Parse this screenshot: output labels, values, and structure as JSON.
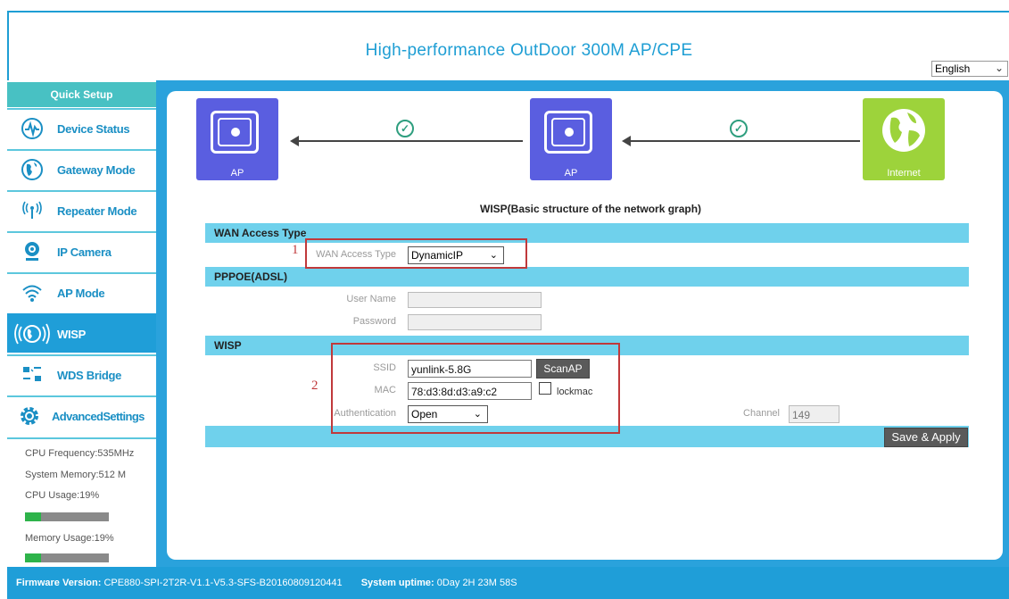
{
  "header": {
    "title": "High-performance OutDoor 300M AP/CPE",
    "language": "English"
  },
  "sidebar": {
    "quick_setup": "Quick Setup",
    "items": [
      {
        "label": "Device Status",
        "icon": "pulse-icon"
      },
      {
        "label": "Gateway Mode",
        "icon": "globe-icon"
      },
      {
        "label": "Repeater Mode",
        "icon": "antenna-icon"
      },
      {
        "label": "IP Camera",
        "icon": "camera-icon"
      },
      {
        "label": "AP Mode",
        "icon": "wifi-icon"
      },
      {
        "label": "WISP",
        "icon": "wisp-globe-icon",
        "active": true
      },
      {
        "label": "WDS Bridge",
        "icon": "bridge-icon"
      },
      {
        "label": "AdvancedSettings",
        "icon": "gear-icon"
      }
    ],
    "stats": {
      "cpu_freq": "CPU Frequency:535MHz",
      "memory": "System Memory:512 M",
      "cpu_usage": "CPU Usage:19%",
      "cpu_usage_value": 0.19,
      "mem_usage": "Memory Usage:19%",
      "mem_usage_value": 0.19
    }
  },
  "diagram": {
    "ap1_label": "AP",
    "ap2_label": "AP",
    "internet_label": "Internet",
    "caption": "WISP(Basic structure of the network graph)"
  },
  "sections": {
    "wan": "WAN Access Type",
    "pppoe": "PPPOE(ADSL)",
    "wisp": "WISP"
  },
  "form": {
    "wan_access_label": "WAN Access Type",
    "wan_access_value": "DynamicIP",
    "username_label": "User Name",
    "password_label": "Password",
    "ssid_label": "SSID",
    "ssid_value": "yunlink-5.8G",
    "scan_button": "ScanAP",
    "mac_label": "MAC",
    "mac_value": "78:d3:8d:d3:a9:c2",
    "lockmac_label": "lockmac",
    "auth_label": "Authentication",
    "auth_value": "Open",
    "channel_label": "Channel",
    "channel_value": "149",
    "save_button": "Save & Apply"
  },
  "annotations": {
    "marker1": "1",
    "marker2": "2"
  },
  "footer": {
    "firmware_label": "Firmware Version:",
    "firmware_value": "CPE880-SPI-2T2R-V1.1-V5.3-SFS-B20160809120441",
    "uptime_label": "System uptime:",
    "uptime_value": "0Day 2H 23M 58S"
  }
}
